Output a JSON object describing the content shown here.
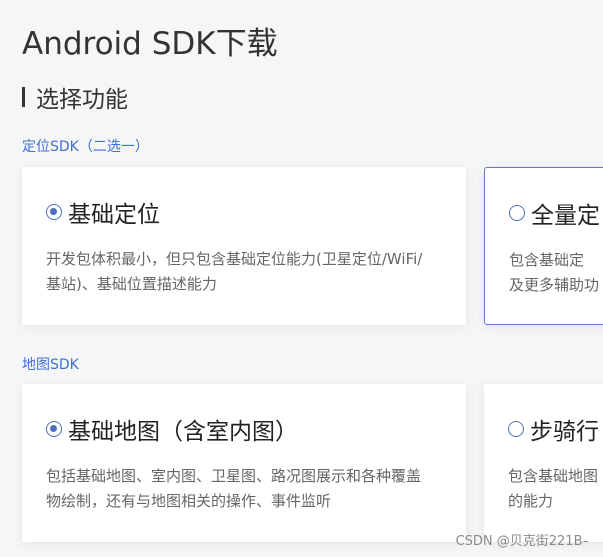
{
  "page": {
    "title": "Android SDK下载"
  },
  "section": {
    "title": "选择功能"
  },
  "location_group": {
    "label": "定位SDK（二选一）",
    "cards": [
      {
        "title": "基础定位",
        "selected": true,
        "desc": "开发包体积最小，但只包含基础定位能力(卫星定位/WiFi/基站)、基础位置描述能力"
      },
      {
        "title": "全量定",
        "selected": false,
        "desc_line1": "包含基础定",
        "desc_line2": "及更多辅助功"
      }
    ]
  },
  "map_group": {
    "label": "地图SDK",
    "cards": [
      {
        "title": "基础地图（含室内图）",
        "selected": true,
        "desc": "包括基础地图、室内图、卫星图、路况图展示和各种覆盖物绘制，还有与地图相关的操作、事件监听"
      },
      {
        "title": "步骑行",
        "selected": false,
        "desc_line1": "包含基础地图",
        "desc_line2": "的能力"
      }
    ]
  },
  "watermark": "CSDN @贝克街221B–",
  "colors": {
    "accent": "#4e6fbf",
    "group_label": "#3f6fd0",
    "background": "#f5f6f8"
  }
}
